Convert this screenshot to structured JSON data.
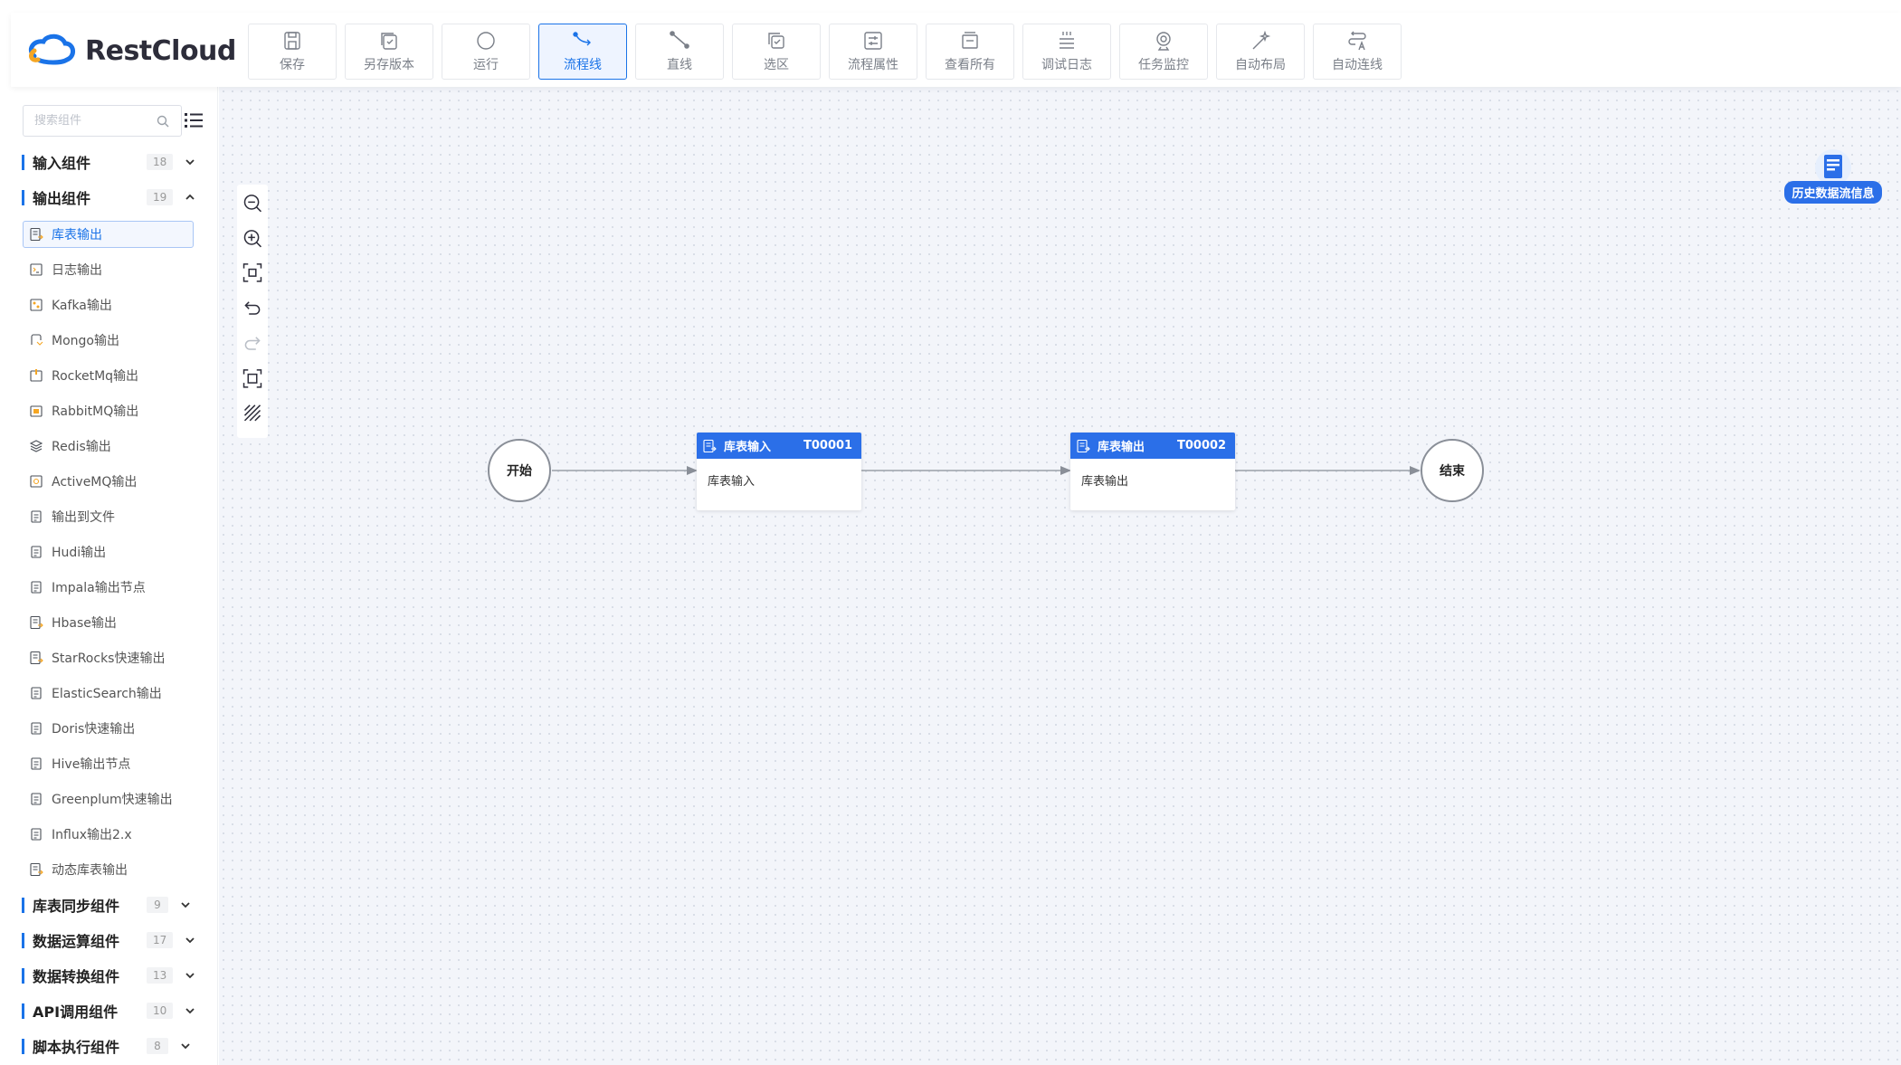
{
  "app": {
    "logo_text": "RestCloud",
    "brand_color": "#1a73e8"
  },
  "toolbar": [
    {
      "label": "保存",
      "icon": "save-icon"
    },
    {
      "label": "另存版本",
      "icon": "save-version-icon"
    },
    {
      "label": "运行",
      "icon": "run-icon"
    },
    {
      "label": "流程线",
      "icon": "flow-line-icon",
      "active": true
    },
    {
      "label": "直线",
      "icon": "straight-line-icon"
    },
    {
      "label": "选区",
      "icon": "selection-icon"
    },
    {
      "label": "流程属性",
      "icon": "flow-properties-icon"
    },
    {
      "label": "查看所有",
      "icon": "view-all-icon"
    },
    {
      "label": "调试日志",
      "icon": "debug-log-icon"
    },
    {
      "label": "任务监控",
      "icon": "task-monitor-icon"
    },
    {
      "label": "自动布局",
      "icon": "auto-layout-icon"
    },
    {
      "label": "自动连线",
      "icon": "auto-connect-icon"
    }
  ],
  "sidebar": {
    "search_placeholder": "搜索组件",
    "groups": [
      {
        "name": "输入组件",
        "count": "18",
        "expanded": false
      },
      {
        "name": "输出组件",
        "count": "19",
        "expanded": true
      },
      {
        "name": "库表同步组件",
        "count": "9",
        "expanded": false
      },
      {
        "name": "数据运算组件",
        "count": "17",
        "expanded": false
      },
      {
        "name": "数据转换组件",
        "count": "13",
        "expanded": false
      },
      {
        "name": "API调用组件",
        "count": "10",
        "expanded": false
      },
      {
        "name": "脚本执行组件",
        "count": "8",
        "expanded": false
      }
    ],
    "output_items": [
      "库表输出",
      "日志输出",
      "Kafka输出",
      "Mongo输出",
      "RocketMq输出",
      "RabbitMQ输出",
      "Redis输出",
      "ActiveMQ输出",
      "输出到文件",
      "Hudi输出",
      "Impala输出节点",
      "Hbase输出",
      "StarRocks快速输出",
      "ElasticSearch输出",
      "Doris快速输出",
      "Hive输出节点",
      "Greenplum快速输出",
      "Influx输出2.x",
      "动态库表输出"
    ],
    "active_item": "库表输出"
  },
  "canvas": {
    "start_label": "开始",
    "end_label": "结束",
    "nodes": [
      {
        "title": "库表输入",
        "id": "T00001",
        "body": "库表输入"
      },
      {
        "title": "库表输出",
        "id": "T00002",
        "body": "库表输出"
      }
    ],
    "history_label": "历史数据流信息"
  }
}
